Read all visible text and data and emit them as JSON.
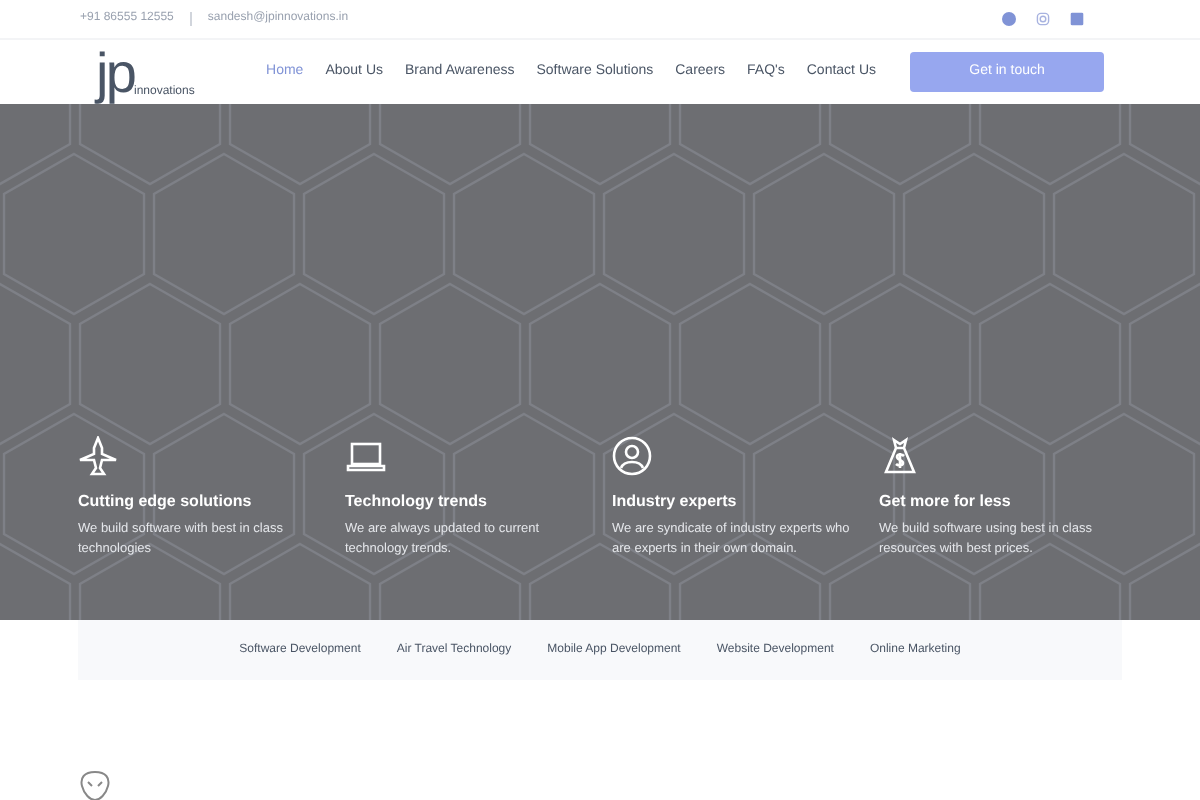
{
  "top_bar": {
    "phone": "+91 86555 12555",
    "email": "sandesh@jpinnovations.in"
  },
  "logo": {
    "mark": "jp",
    "word": "innovations"
  },
  "nav": [
    {
      "label": "Home",
      "selected": true
    },
    {
      "label": "About Us",
      "selected": false
    },
    {
      "label": "Brand Awareness",
      "selected": false
    },
    {
      "label": "Software Solutions",
      "selected": false
    },
    {
      "label": "Careers",
      "selected": false
    },
    {
      "label": "FAQ's",
      "selected": false
    },
    {
      "label": "Contact Us",
      "selected": false
    }
  ],
  "cta": "Get in touch",
  "features": [
    {
      "kind": "plane",
      "title": "Cutting edge solutions",
      "text": "We build software with best in class technologies"
    },
    {
      "kind": "laptop",
      "title": "Technology trends",
      "text": "We are always updated to current technology trends."
    },
    {
      "kind": "user",
      "title": "Industry experts",
      "text": "We are syndicate of industry experts who are experts in their own domain."
    },
    {
      "kind": "money",
      "title": "Get more for less",
      "text": "We build software using best in class resources with best prices."
    }
  ],
  "services": [
    "Software Development",
    "Air Travel Technology",
    "Mobile App Development",
    "Website Development",
    "Online Marketing"
  ]
}
